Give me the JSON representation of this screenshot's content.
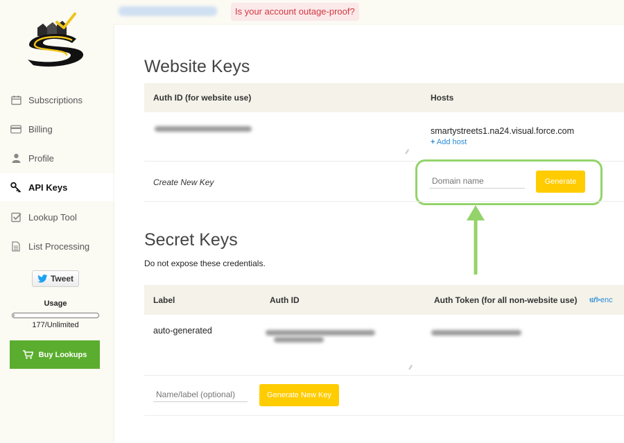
{
  "topbar": {
    "outage_link": "Is your account outage-proof?"
  },
  "sidebar": {
    "items": [
      {
        "label": "Subscriptions",
        "icon": "calendar-icon"
      },
      {
        "label": "Billing",
        "icon": "credit-card-icon"
      },
      {
        "label": "Profile",
        "icon": "user-icon"
      },
      {
        "label": "API Keys",
        "icon": "key-icon"
      },
      {
        "label": "Lookup Tool",
        "icon": "check-square-icon"
      },
      {
        "label": "List Processing",
        "icon": "file-list-icon"
      }
    ],
    "tweet_label": "Tweet",
    "usage_title": "Usage",
    "usage_count": "177/Unlimited",
    "buy_label": "Buy Lookups"
  },
  "website_keys": {
    "title": "Website Keys",
    "col_auth": "Auth ID (for website use)",
    "col_hosts": "Hosts",
    "host": "smartystreets1.na24.visual.force.com",
    "add_host": "Add host",
    "create_label": "Create New Key",
    "domain_placeholder": "Domain name",
    "generate_label": "Generate"
  },
  "secret_keys": {
    "title": "Secret Keys",
    "subtitle": "Do not expose these credentials.",
    "col_label": "Label",
    "col_auth_id": "Auth ID",
    "col_auth_token": "Auth Token (for all non-website use)",
    "url_enc": "url-enc",
    "row_label": "auto-generated",
    "label_placeholder": "Name/label (optional)",
    "generate_new_label": "Generate New Key"
  },
  "colors": {
    "accent_yellow": "#ffcc00",
    "buy_green": "#5aad2e",
    "highlight_green": "#93d36a",
    "link_blue": "#2a8bd8",
    "outage_red": "#d0373f"
  }
}
